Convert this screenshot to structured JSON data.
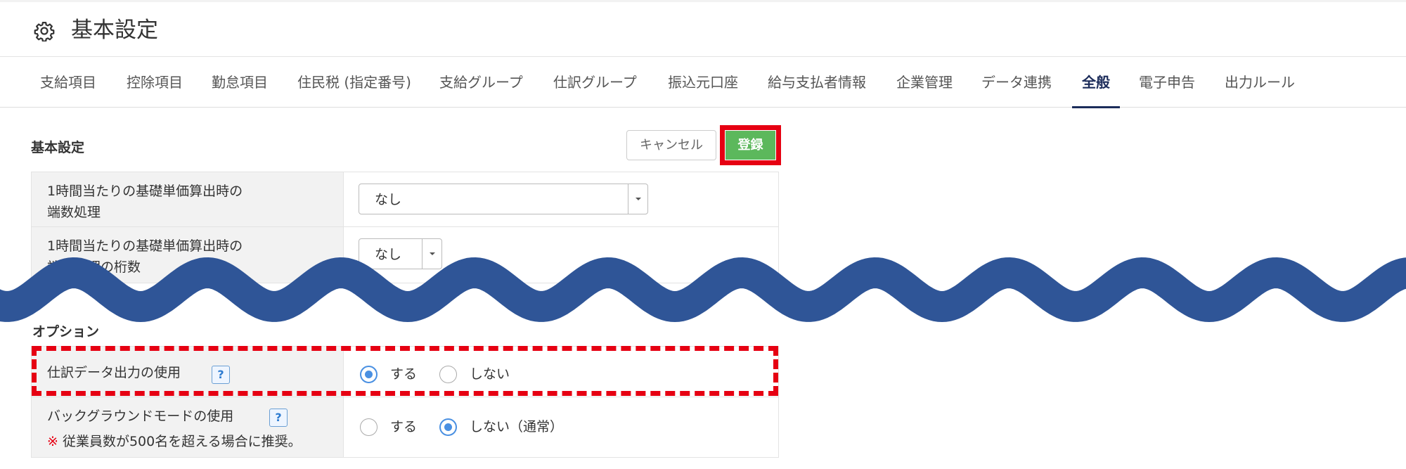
{
  "header": {
    "title": "基本設定",
    "icon": "gear-icon"
  },
  "tabs": [
    {
      "label": "支給項目",
      "active": false
    },
    {
      "label": "控除項目",
      "active": false
    },
    {
      "label": "勤怠項目",
      "active": false
    },
    {
      "label": "住民税 (指定番号)",
      "active": false
    },
    {
      "label": "支給グループ",
      "active": false
    },
    {
      "label": "仕訳グループ",
      "active": false
    },
    {
      "label": "振込元口座",
      "active": false
    },
    {
      "label": "給与支払者情報",
      "active": false
    },
    {
      "label": "企業管理",
      "active": false
    },
    {
      "label": "データ連携",
      "active": false
    },
    {
      "label": "全般",
      "active": true
    },
    {
      "label": "電子申告",
      "active": false
    },
    {
      "label": "出力ルール",
      "active": false
    }
  ],
  "basic": {
    "title": "基本設定",
    "cancel_label": "キャンセル",
    "save_label": "登録",
    "rows": [
      {
        "label_line1": "1時間当たりの基礎単価算出時の",
        "label_line2": "端数処理",
        "value": "なし"
      },
      {
        "label_line1": "1時間当たりの基礎単価算出時の",
        "label_line2": "端数処理の桁数",
        "value": "なし"
      }
    ]
  },
  "options": {
    "title": "オプション",
    "rows": [
      {
        "label": "仕訳データ出力の使用",
        "help": "?",
        "option_yes": "する",
        "option_no": "しない",
        "selected": "yes"
      },
      {
        "label": "バックグラウンドモードの使用",
        "help": "?",
        "note_mark": "※",
        "note": " 従業員数が500名を超える場合に推奨。",
        "option_yes": "する",
        "option_no": "しない（通常）",
        "selected": "no"
      }
    ]
  },
  "colors": {
    "accent": "#1c2c5a",
    "save_button": "#5cb85c",
    "highlight": "#e60012",
    "wave": "#2f5597",
    "radio": "#4a90e2"
  }
}
